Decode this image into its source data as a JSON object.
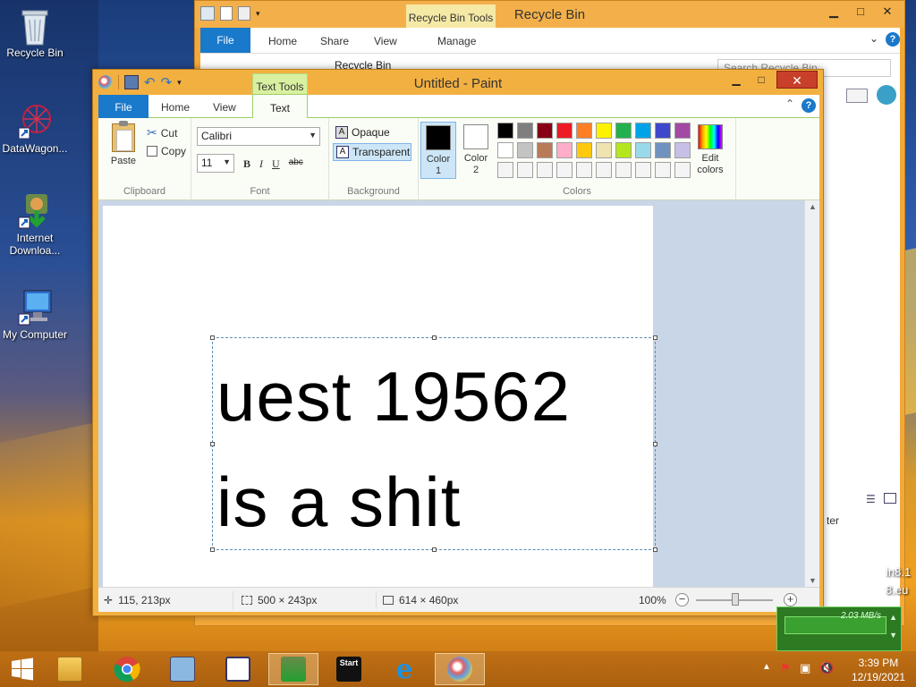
{
  "desktop": {
    "icons": [
      {
        "label": "Recycle Bin"
      },
      {
        "label": "DataWagon..."
      },
      {
        "label": "Internet Downloa..."
      },
      {
        "label": "My Computer"
      }
    ],
    "side_text_1": "in8.1",
    "side_text_2": "8.eu"
  },
  "recycle_bin": {
    "title": "Recycle Bin",
    "context_tab": "Recycle Bin Tools",
    "tabs": [
      "File",
      "Home",
      "Share",
      "View",
      "Manage"
    ],
    "address": "Recycle Bin",
    "search_placeholder": "Search Recycle Bin",
    "status_partial": "ter"
  },
  "paint": {
    "title": "Untitled - Paint",
    "context_tab": "Text Tools",
    "tabs": {
      "file": "File",
      "home": "Home",
      "view": "View",
      "text": "Text"
    },
    "clipboard": {
      "paste": "Paste",
      "cut": "Cut",
      "copy": "Copy",
      "label": "Clipboard"
    },
    "font": {
      "family": "Calibri",
      "size": "11",
      "bold": "B",
      "italic": "I",
      "underline": "U",
      "strike": "abc",
      "label": "Font"
    },
    "background": {
      "opaque": "Opaque",
      "transparent": "Transparent",
      "label": "Background"
    },
    "colors": {
      "color1_label": "Color\n1",
      "color1_l1": "Color",
      "color1_l2": "1",
      "color2_l1": "Color",
      "color2_l2": "2",
      "color1": "#000000",
      "color2": "#ffffff",
      "edit_l1": "Edit",
      "edit_l2": "colors",
      "label": "Colors",
      "palette": [
        "#000000",
        "#7f7f7f",
        "#880015",
        "#ed1c24",
        "#ff7f27",
        "#fff200",
        "#22b14c",
        "#00a2e8",
        "#3f48cc",
        "#a349a4",
        "#ffffff",
        "#c3c3c3",
        "#b97a57",
        "#ffaec9",
        "#ffc90e",
        "#efe4b0",
        "#b5e61d",
        "#99d9ea",
        "#7092be",
        "#c8bfe7",
        "#f4f4f4",
        "#f4f4f4",
        "#f4f4f4",
        "#f4f4f4",
        "#f4f4f4",
        "#f4f4f4",
        "#f4f4f4",
        "#f4f4f4",
        "#f4f4f4",
        "#f4f4f4"
      ]
    },
    "canvas_text": {
      "line1": "uest 19562",
      "line2": "is a shit"
    },
    "status": {
      "cursor": "115, 213px",
      "selection": "500 × 243px",
      "size": "614 × 460px",
      "zoom": "100%"
    }
  },
  "taskbar": {
    "clock_time": "3:39 PM",
    "clock_date": "12/19/2021",
    "start_label": "Start",
    "net_speed": "2.03 MB/s"
  }
}
